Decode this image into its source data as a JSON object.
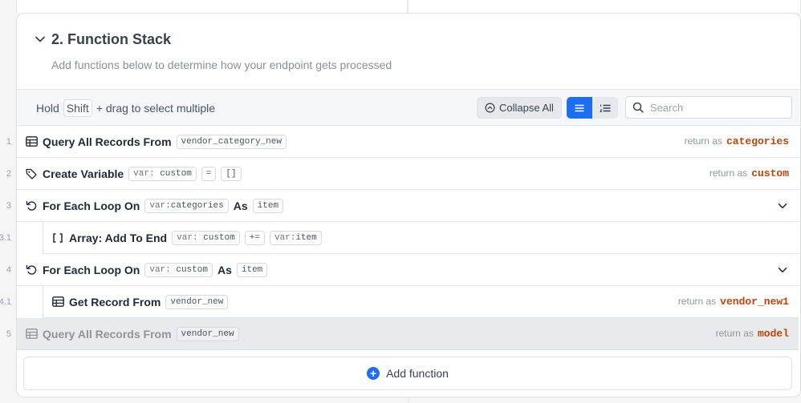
{
  "section": {
    "title": "2. Function Stack",
    "subtitle": "Add functions below to determine how your endpoint gets processed"
  },
  "toolbar": {
    "hold_prefix": "Hold",
    "shift_key": "Shift",
    "hold_suffix": "+ drag to select multiple",
    "collapse_all_label": "Collapse All",
    "search_placeholder": "Search",
    "view_mode": "list"
  },
  "functions": [
    {
      "line": "1",
      "icon": "table-icon",
      "name": "Query All Records From",
      "chips": [
        "vendor_category_new"
      ],
      "return_label": "return as",
      "return_var": "categories"
    },
    {
      "line": "2",
      "icon": "tag-icon",
      "name": "Create Variable",
      "chips_var": {
        "pre": "var:",
        "val": "custom"
      },
      "op": "=",
      "value": "[]",
      "return_label": "return as",
      "return_var": "custom"
    },
    {
      "line": "3",
      "icon": "loop-icon",
      "name": "For Each Loop On",
      "var_chip": {
        "pre": "var:",
        "val": "categories"
      },
      "conj": "As",
      "as_chip": "item"
    },
    {
      "line": "3.1",
      "icon": "array-icon",
      "name": "Array: Add To End",
      "var_chip": {
        "pre": "var:",
        "val": "custom"
      },
      "op": "+=",
      "value_chip": {
        "pre": "var:",
        "val": "item"
      }
    },
    {
      "line": "4",
      "icon": "loop-icon",
      "name": "For Each Loop On",
      "var_chip": {
        "pre": "var:",
        "val": "custom"
      },
      "conj": "As",
      "as_chip": "item"
    },
    {
      "line": "4.1",
      "icon": "table-icon",
      "name": "Get Record From",
      "chips": [
        "vendor_new"
      ],
      "return_label": "return as",
      "return_var": "vendor_new1"
    },
    {
      "line": "5",
      "icon": "table-icon",
      "name": "Query All Records From",
      "chips": [
        "vendor_new"
      ],
      "return_label": "return as",
      "return_var": "model",
      "disabled": true
    }
  ],
  "add_function_label": "Add function",
  "colors": {
    "accent": "#1d6ef2",
    "return_var": "#c2410c"
  }
}
